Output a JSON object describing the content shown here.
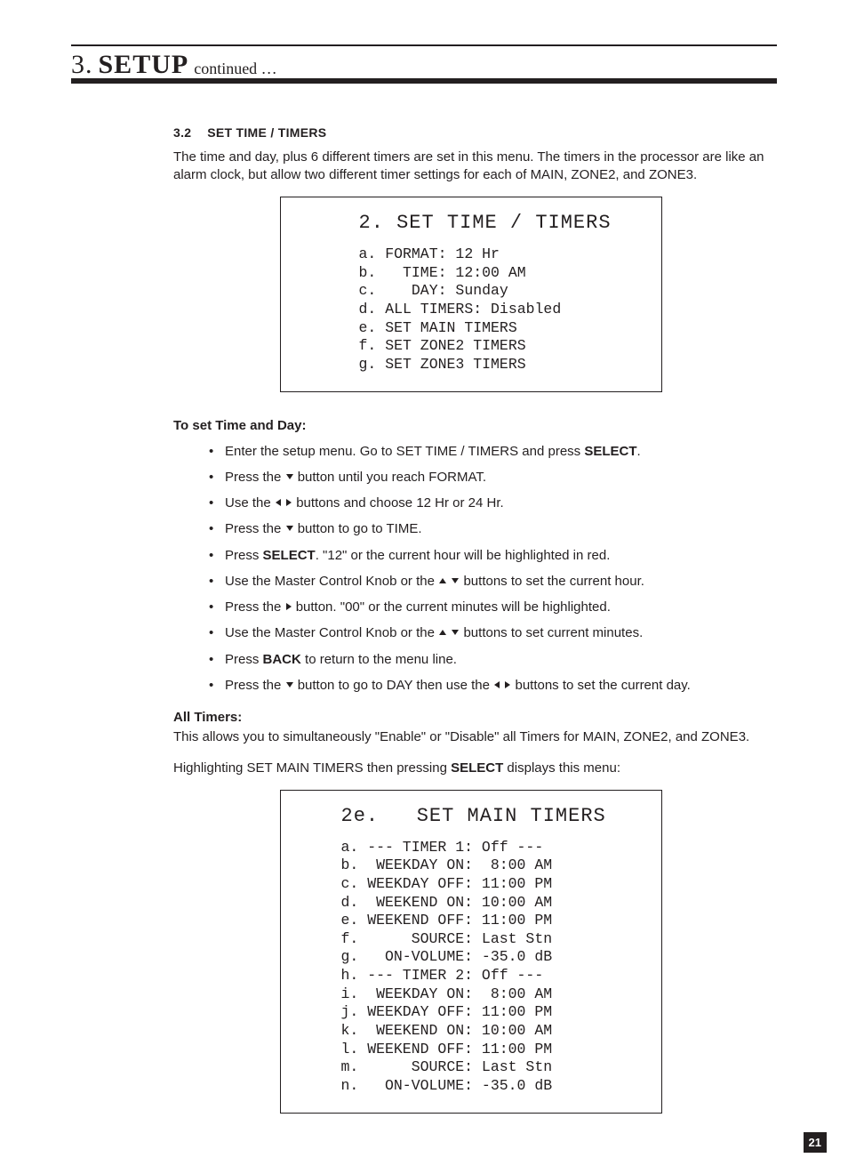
{
  "header": {
    "chapter_number": "3.",
    "chapter_word": "SETUP",
    "continued": "continued …"
  },
  "section": {
    "number": "3.2",
    "title": "SET TIME / TIMERS",
    "intro": "The time and day, plus 6 different timers are set in this menu. The timers in the processor are like an alarm clock, but allow two different timer settings for each of MAIN, ZONE2, and ZONE3."
  },
  "menu1": {
    "title": "2. SET TIME / TIMERS",
    "lines": [
      "a. FORMAT: 12 Hr",
      "b.   TIME: 12:00 AM",
      "c.    DAY: Sunday",
      "d. ALL TIMERS: Disabled",
      "e. SET MAIN TIMERS",
      "f. SET ZONE2 TIMERS",
      "g. SET ZONE3 TIMERS"
    ]
  },
  "time_day": {
    "heading": "To set Time and Day:",
    "steps": {
      "s0a": "Enter the setup menu. Go to SET TIME / TIMERS and press ",
      "s0b": "SELECT",
      "s0c": ".",
      "s1a": "Press the ",
      "s1b": " button until you reach FORMAT.",
      "s2a": "Use the ",
      "s2b": " buttons and choose 12 Hr or 24 Hr.",
      "s3a": "Press the ",
      "s3b": " button to go to TIME.",
      "s4a": "Press ",
      "s4b": "SELECT",
      "s4c": ". \"12\" or the current hour will be highlighted in red.",
      "s5a": "Use the Master Control Knob or the ",
      "s5b": " buttons to set the current hour.",
      "s6a": "Press the ",
      "s6b": " button. \"00\" or the current minutes will be highlighted.",
      "s7a": "Use the Master Control Knob or the ",
      "s7b": " buttons to set current minutes.",
      "s8a": "Press ",
      "s8b": "BACK",
      "s8c": " to return to the menu line.",
      "s9a": "Press the ",
      "s9b": " button to go to DAY then use the ",
      "s9c": " buttons to set the current day."
    }
  },
  "all_timers": {
    "heading": "All Timers:",
    "text": "This allows you to simultaneously \"Enable\" or \"Disable\" all Timers for MAIN, ZONE2, and ZONE3."
  },
  "highlighting": {
    "pre": "Highlighting SET MAIN TIMERS then pressing ",
    "bold": "SELECT",
    "post": " displays this menu:"
  },
  "menu2": {
    "title": "2e.   SET MAIN TIMERS",
    "lines": [
      "a. --- TIMER 1: Off ---",
      "b.  WEEKDAY ON:  8:00 AM",
      "c. WEEKDAY OFF: 11:00 PM",
      "d.  WEEKEND ON: 10:00 AM",
      "e. WEEKEND OFF: 11:00 PM",
      "f.      SOURCE: Last Stn",
      "g.   ON-VOLUME: -35.0 dB",
      "h. --- TIMER 2: Off ---",
      "i.  WEEKDAY ON:  8:00 AM",
      "j. WEEKDAY OFF: 11:00 PM",
      "k.  WEEKEND ON: 10:00 AM",
      "l. WEEKEND OFF: 11:00 PM",
      "m.      SOURCE: Last Stn",
      "n.   ON-VOLUME: -35.0 dB"
    ]
  },
  "page_number": "21"
}
